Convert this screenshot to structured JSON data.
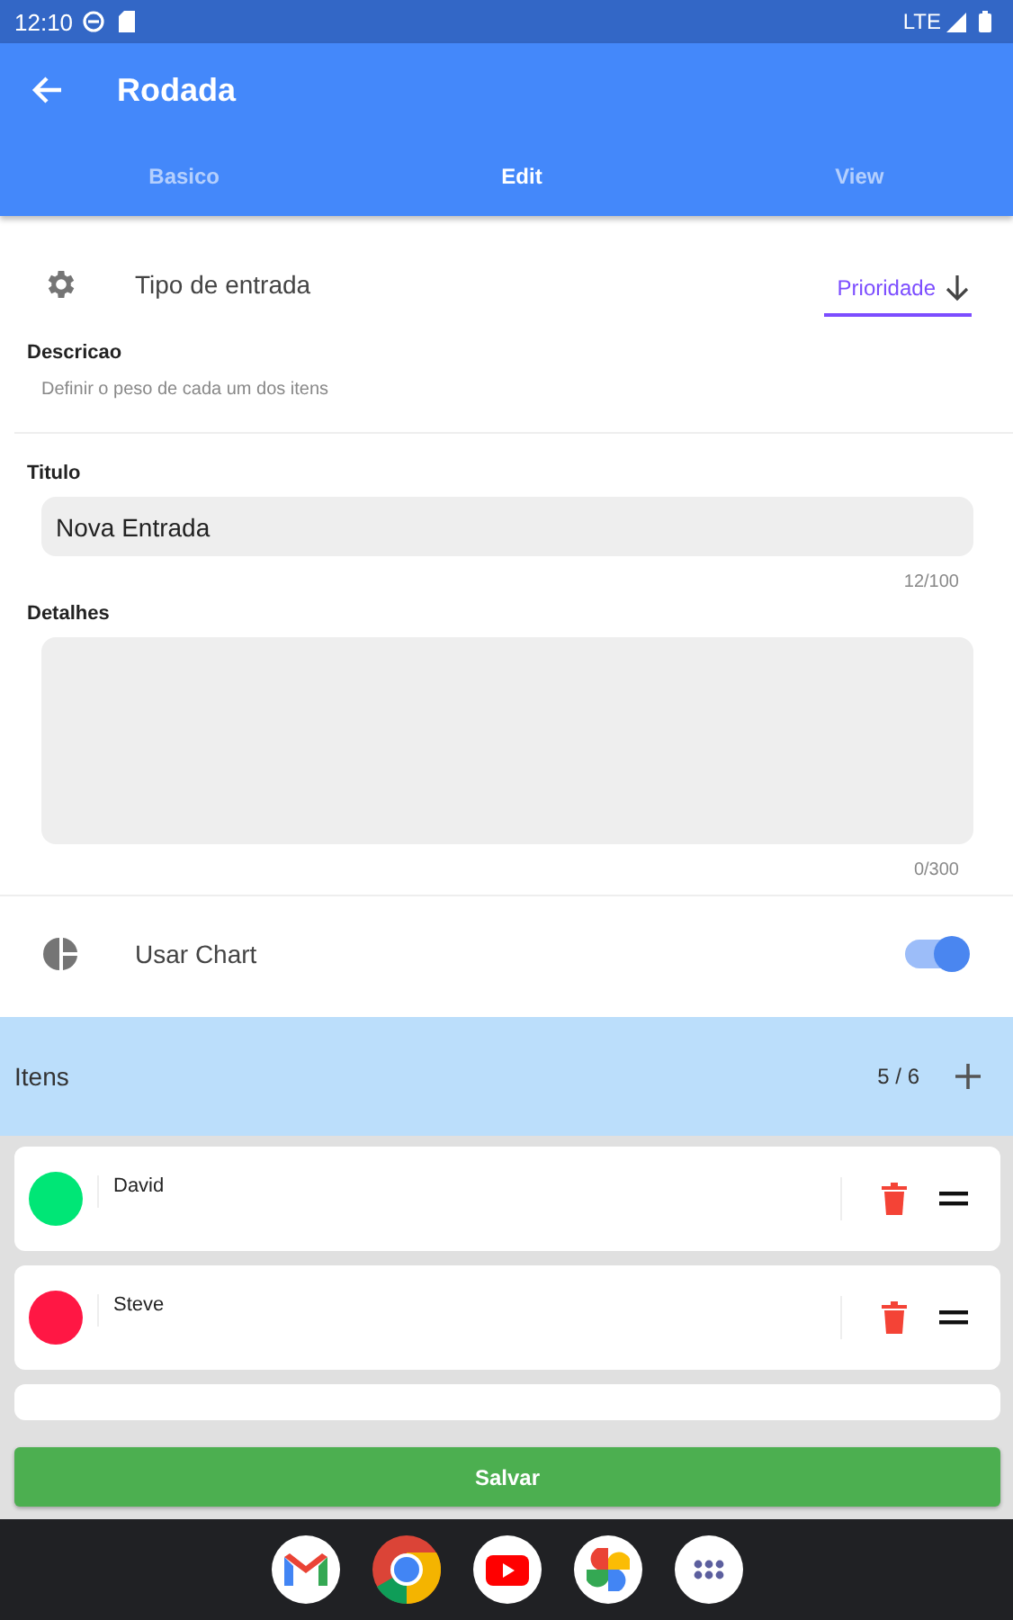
{
  "status_bar": {
    "time": "12:10",
    "network": "LTE"
  },
  "app_bar": {
    "title": "Rodada"
  },
  "tabs": [
    {
      "label": "Basico",
      "selected": false
    },
    {
      "label": "Edit",
      "selected": true
    },
    {
      "label": "View",
      "selected": false
    }
  ],
  "entry_type": {
    "label": "Tipo de entrada",
    "value": "Prioridade"
  },
  "description": {
    "label": "Descricao",
    "text": "Definir o peso de cada um dos itens"
  },
  "title_field": {
    "label": "Titulo",
    "value": "Nova Entrada",
    "counter": "12/100"
  },
  "details_field": {
    "label": "Detalhes",
    "counter": "0/300"
  },
  "use_chart": {
    "label": "Usar Chart",
    "on": true
  },
  "items_header": {
    "label": "Itens",
    "count": "5 / 6"
  },
  "items": [
    {
      "name": "David",
      "color": "#00e676"
    },
    {
      "name": "Steve",
      "color": "#ff1744"
    }
  ],
  "save_button": {
    "label": "Salvar"
  },
  "dock": [
    {
      "kind": "mail"
    },
    {
      "kind": "browser"
    },
    {
      "kind": "video"
    },
    {
      "kind": "photos"
    },
    {
      "kind": "apps"
    }
  ]
}
